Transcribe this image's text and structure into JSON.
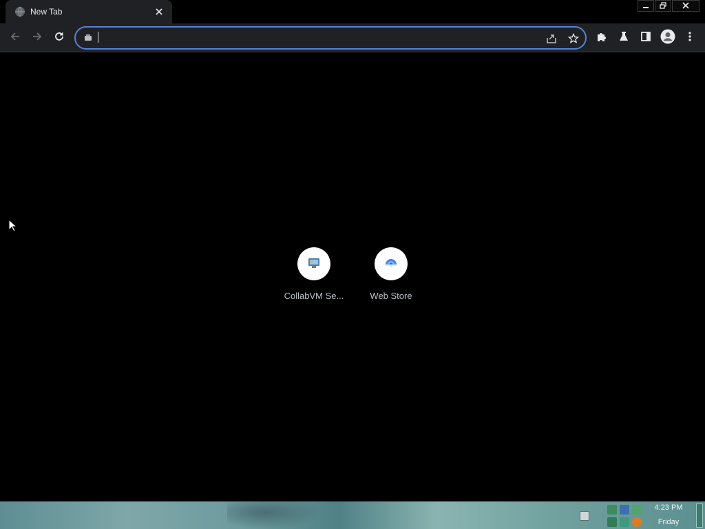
{
  "tab": {
    "title": "New Tab",
    "favicon": "globe-icon",
    "close_icon": "close-icon"
  },
  "window_controls": [
    "minimize-icon",
    "restore-icon",
    "close-icon"
  ],
  "toolbar": {
    "back_icon": "arrow-left-icon",
    "forward_icon": "arrow-right-icon",
    "reload_icon": "reload-icon",
    "omnibox": {
      "value": "",
      "placeholder": "",
      "left_icon": "search-engine-icon",
      "share_icon": "share-icon",
      "bookmark_icon": "star-icon"
    },
    "extensions_icon": "puzzle-icon",
    "labs_icon": "flask-icon",
    "side_panel_icon": "side-panel-icon",
    "profile_icon": "avatar-icon",
    "menu_icon": "kebab-menu-icon"
  },
  "shortcuts": [
    {
      "label": "CollabVM Se...",
      "icon": "collabvm-icon"
    },
    {
      "label": "Web Store",
      "icon": "web-store-icon"
    }
  ],
  "taskbar": {
    "clock_time": "4:23 PM",
    "clock_day": "Friday"
  },
  "colors": {
    "accent": "#5683d6",
    "toolbar_bg": "#202124",
    "page_bg": "#000000",
    "text": "#e8eaed",
    "tile_label": "#bdc1c6"
  }
}
